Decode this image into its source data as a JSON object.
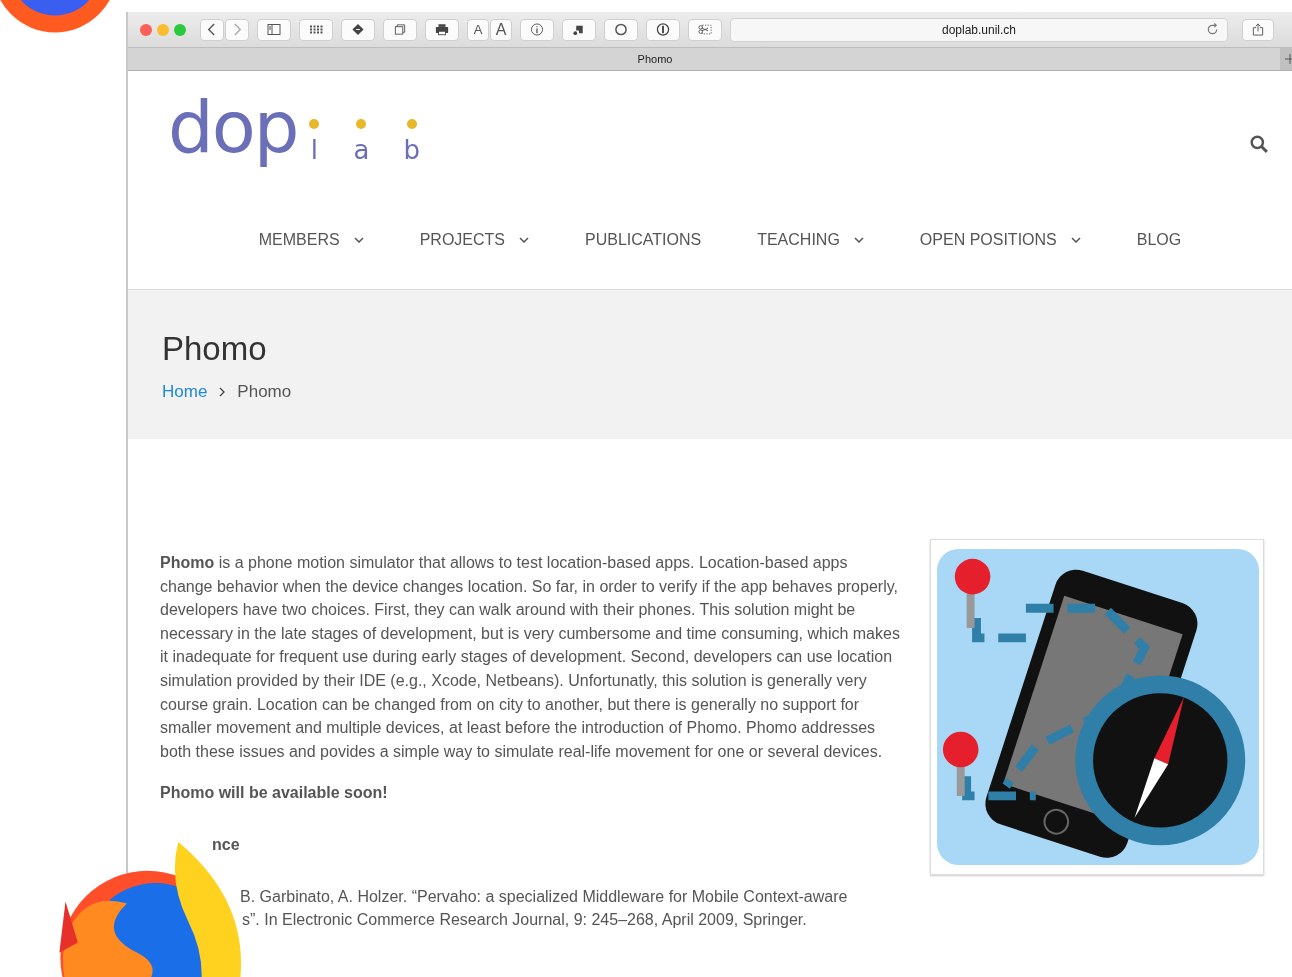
{
  "browser": {
    "address": "doplab.unil.ch",
    "tab_title": "Phomo",
    "font_buttons": [
      "A",
      "A"
    ]
  },
  "site": {
    "logo_main": "dop",
    "logo_letters": [
      "l",
      "a",
      "b"
    ],
    "nav": [
      {
        "label": "MEMBERS",
        "has_dropdown": true
      },
      {
        "label": "PROJECTS",
        "has_dropdown": true
      },
      {
        "label": "PUBLICATIONS",
        "has_dropdown": false
      },
      {
        "label": "TEACHING",
        "has_dropdown": true
      },
      {
        "label": "OPEN POSITIONS",
        "has_dropdown": true
      },
      {
        "label": "BLOG",
        "has_dropdown": false
      }
    ]
  },
  "page": {
    "title": "Phomo",
    "breadcrumb": [
      {
        "label": "Home",
        "link": true
      },
      {
        "label": "Phomo",
        "link": false
      }
    ],
    "intro": "**Phomo** is a phone motion simulator that allows to test location-based apps. Location-based apps change behavior when the device changes location. So far, in order to verify if the app behaves properly, developers have two choices. First, they can walk around with their phones. This solution might be necessary in the late stages of development, but is very cumbersome and time consuming, which makes it inadequate for frequent use during early stages of development. Second, developers can use location simulation provided by their IDE (e.g., Xcode, Netbeans). Unfortunatly, this solution is generally very course grain. Location can be changed from on city to another, but there is generally no support for smaller movement and multiple devices, at least before the introduction of Phomo. Phomo addresses both these issues and povides a simple way to simulate real-life movement for one or several devices.",
    "availability": "Phomo will be available soon!",
    "section_heading": "nce",
    "reference_lines": [
      "B. Garbinato, A. Holzer. “Pervaho: a specialized Middleware for Mobile Context-aware",
      "s”. In Electronic Commerce Research Journal, 9: 245–268, April 2009, Springer."
    ]
  }
}
